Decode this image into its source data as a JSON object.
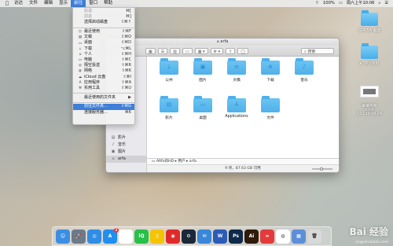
{
  "menubar": {
    "items": [
      "访达",
      "文件",
      "编辑",
      "显示",
      "前往",
      "窗口",
      "帮助"
    ],
    "active_index": 4,
    "status": [
      "100%",
      "周六上午10:06"
    ]
  },
  "go_menu": {
    "items": [
      {
        "label": "后退",
        "shortcut": "⌘[",
        "disabled": true
      },
      {
        "label": "前进",
        "shortcut": "⌘]",
        "disabled": true
      },
      {
        "label": "选择启动磁盘",
        "shortcut": "⇧⌘↑",
        "disabled": false
      },
      {
        "sep": true
      },
      {
        "label": "最近使用",
        "shortcut": "⇧⌘F",
        "icon": "clock-icon"
      },
      {
        "label": "文稿",
        "shortcut": "⇧⌘O",
        "icon": "document-icon"
      },
      {
        "label": "桌面",
        "shortcut": "⇧⌘D",
        "icon": "desktop-icon"
      },
      {
        "label": "下载",
        "shortcut": "⌥⌘L",
        "icon": "download-icon"
      },
      {
        "label": "个人",
        "shortcut": "⇧⌘H",
        "icon": "home-icon"
      },
      {
        "label": "电脑",
        "shortcut": "⇧⌘C",
        "icon": "computer-icon"
      },
      {
        "label": "隔空投送",
        "shortcut": "⇧⌘R",
        "icon": "airdrop-icon"
      },
      {
        "label": "网络",
        "shortcut": "⇧⌘K",
        "icon": "network-icon"
      },
      {
        "label": "iCloud 云盘",
        "shortcut": "⇧⌘I",
        "icon": "cloud-icon"
      },
      {
        "label": "应用程序",
        "shortcut": "⇧⌘A",
        "icon": "apps-icon"
      },
      {
        "label": "实用工具",
        "shortcut": "⇧⌘U",
        "icon": "tools-icon"
      },
      {
        "sep": true
      },
      {
        "label": "最近使用的文件夹",
        "shortcut": "▶"
      },
      {
        "sep": true
      },
      {
        "label": "前往文件夹…",
        "shortcut": "⇧⌘G",
        "highlighted": true
      },
      {
        "label": "连接服务器…",
        "shortcut": "⌘K"
      }
    ]
  },
  "finder": {
    "title": "arfa",
    "search_placeholder": "搜索",
    "sidebar": [
      {
        "label": "",
        "icon": "blank"
      },
      {
        "label": "",
        "icon": "blank"
      },
      {
        "label": "",
        "icon": "blank"
      },
      {
        "label": "",
        "icon": "blank"
      },
      {
        "label": "",
        "icon": "blank"
      },
      {
        "label": "",
        "icon": "blank"
      },
      {
        "label": "",
        "icon": "blank"
      },
      {
        "label": "",
        "icon": "blank"
      },
      {
        "label": "",
        "icon": "blank"
      },
      {
        "label": "",
        "icon": "blank"
      },
      {
        "label": "",
        "icon": "blank"
      },
      {
        "label": "影片",
        "icon": "film-icon"
      },
      {
        "label": "音乐",
        "icon": "music-icon"
      },
      {
        "label": "图片",
        "icon": "image-icon"
      },
      {
        "label": "arfa",
        "icon": "home-icon",
        "selected": true
      }
    ],
    "folders": [
      {
        "label": "公共",
        "glyph": "⇣"
      },
      {
        "label": "图片",
        "glyph": "▣"
      },
      {
        "label": "文稿",
        "glyph": "≡"
      },
      {
        "label": "下载",
        "glyph": "⊕"
      },
      {
        "label": "音乐",
        "glyph": "♪"
      },
      {
        "label": "影片",
        "glyph": "▤"
      },
      {
        "label": "桌面",
        "glyph": "▭"
      },
      {
        "label": "Applications",
        "glyph": "A"
      },
      {
        "label": "文件",
        "glyph": ""
      }
    ],
    "path": "ARfa的HD ▸ 用户 ▸ arfa",
    "status": "9 项，87.63 GB 可用"
  },
  "desktop_icons": [
    {
      "label": "GTA 5A 截图",
      "kind": "folder"
    },
    {
      "label": "a. 学习资料",
      "kind": "folder"
    },
    {
      "label": "屏幕快照\n2018-02...10.06.24",
      "kind": "thumb"
    }
  ],
  "dock": [
    {
      "name": "finder",
      "color": "#3b8fe3",
      "glyph": "☺"
    },
    {
      "name": "launchpad",
      "color": "#6c7a8a",
      "glyph": "🚀"
    },
    {
      "name": "safari",
      "color": "#2f8de4",
      "glyph": "◎"
    },
    {
      "name": "app-store",
      "color": "#1f8ff0",
      "glyph": "A",
      "badge": true
    },
    {
      "name": "calendar",
      "color": "#ffffff",
      "glyph": ""
    },
    {
      "name": "iqiyi",
      "color": "#27c04a",
      "glyph": "iQ"
    },
    {
      "name": "qq-music",
      "color": "#f4c400",
      "glyph": "♫"
    },
    {
      "name": "netease-music",
      "color": "#e02a2a",
      "glyph": "◉"
    },
    {
      "name": "steam",
      "color": "#1b2838",
      "glyph": "⚙"
    },
    {
      "name": "mail",
      "color": "#3a86d8",
      "glyph": "✉"
    },
    {
      "name": "word",
      "color": "#2b5cb8",
      "glyph": "W"
    },
    {
      "name": "photoshop",
      "color": "#0f2a4a",
      "glyph": "Ps"
    },
    {
      "name": "illustrator",
      "color": "#2e1b0a",
      "glyph": "Ai"
    },
    {
      "name": "creative-cloud",
      "color": "#e23b3b",
      "glyph": "∞"
    },
    {
      "name": "chrome",
      "color": "#ffffff",
      "glyph": "◍"
    },
    {
      "name": "preview",
      "color": "#5d8fd9",
      "glyph": "▦"
    },
    {
      "name": "trash",
      "color": "#d9d9d9",
      "glyph": "🗑"
    }
  ],
  "watermark": {
    "text": "Bai 经验",
    "sub": "jingyan.baidu.com"
  }
}
